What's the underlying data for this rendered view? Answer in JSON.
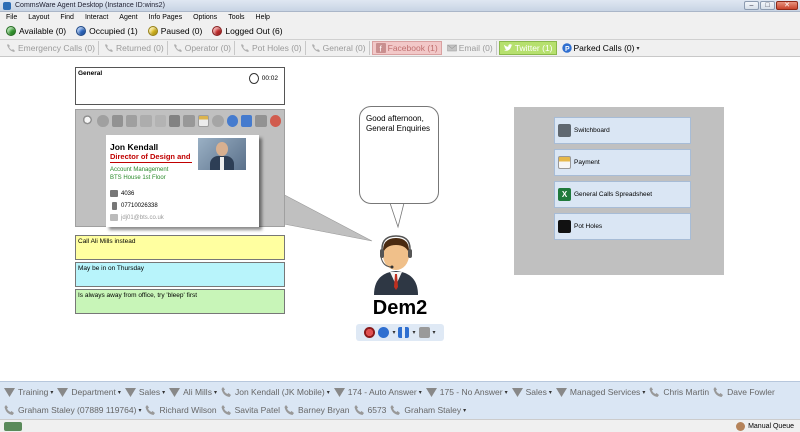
{
  "window": {
    "title": "CommsWare Agent Desktop (Instance ID:wins2)"
  },
  "menu": [
    "File",
    "Layout",
    "Find",
    "Interact",
    "Agent",
    "Info Pages",
    "Options",
    "Tools",
    "Help"
  ],
  "statuses": [
    {
      "label": "Available (0)",
      "color": "#3aa835"
    },
    {
      "label": "Occupied (1)",
      "color": "#2f6fd0"
    },
    {
      "label": "Paused (0)",
      "color": "#e7c520"
    },
    {
      "label": "Logged Out (6)",
      "color": "#d23030"
    }
  ],
  "queues": [
    {
      "label": "Emergency Calls (0)",
      "icon": "phone-icon"
    },
    {
      "label": "Returned (0)",
      "icon": "phone-icon"
    },
    {
      "label": "Operator (0)",
      "icon": "phone-icon"
    },
    {
      "label": "Pot Holes (0)",
      "icon": "phone-icon"
    },
    {
      "label": "General (0)",
      "icon": "phone-icon"
    },
    {
      "label": "Facebook (1)",
      "icon": "facebook-icon"
    },
    {
      "label": "Email (0)",
      "icon": "email-icon"
    },
    {
      "label": "Twitter (1)",
      "icon": "twitter-icon"
    }
  ],
  "parked": {
    "label": "Parked Calls (0)"
  },
  "general": {
    "label": "General",
    "time": "00:02"
  },
  "contact_card": {
    "name": "Jon Kendall",
    "title": "Director of Design and",
    "department": "Account Management",
    "address": "BTS House 1st Floor",
    "extension": "4036",
    "mobile": "07710026338",
    "email": "jdj01@bts.co.uk"
  },
  "notes": [
    {
      "text": "Call Ali Mills instead",
      "color": "#ffffa0"
    },
    {
      "text": "May be in on Thursday",
      "color": "#b8f4fb"
    },
    {
      "text": "Is always away from office, try 'bleep' first",
      "color": "#c8f5b8"
    }
  ],
  "agent": {
    "greeting": "Good afternoon, General Enquiries",
    "name": "Dem2"
  },
  "info_pages": [
    {
      "label": "Switchboard",
      "icon": "switchboard-icon"
    },
    {
      "label": "Payment",
      "icon": "payment-icon"
    },
    {
      "label": "General Calls Spreadsheet",
      "icon": "excel-icon"
    },
    {
      "label": "Pot Holes",
      "icon": "surrey-icon"
    }
  ],
  "contacts": [
    {
      "label": "Training",
      "type": "group"
    },
    {
      "label": "Department",
      "type": "group"
    },
    {
      "label": "Sales",
      "type": "group"
    },
    {
      "label": "Ali Mills",
      "type": "group"
    },
    {
      "label": "Jon Kendall (JK Mobile)",
      "type": "phone"
    },
    {
      "label": "174 - Auto Answer",
      "type": "group"
    },
    {
      "label": "175 - No Answer",
      "type": "group"
    },
    {
      "label": "Sales",
      "type": "group"
    },
    {
      "label": "Managed Services",
      "type": "group"
    },
    {
      "label": "Chris Martin",
      "type": "phone"
    },
    {
      "label": "Dave Fowler",
      "type": "phone"
    },
    {
      "label": "Graham Staley (07889 119764)",
      "type": "phone"
    },
    {
      "label": "Richard Wilson",
      "type": "phone"
    },
    {
      "label": "Savita Patel",
      "type": "phone"
    },
    {
      "label": "Barney Bryan",
      "type": "phone"
    },
    {
      "label": "6573",
      "type": "phone"
    },
    {
      "label": "Graham Staley",
      "type": "phone"
    }
  ],
  "footer": {
    "queue_label": "Manual Queue"
  }
}
